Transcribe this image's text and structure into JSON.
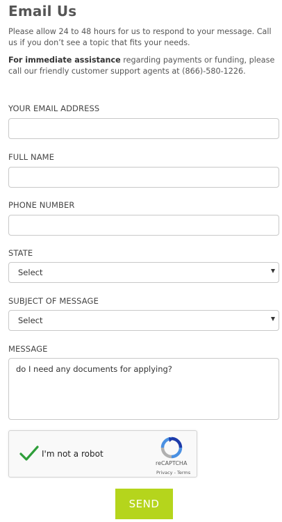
{
  "page": {
    "title": "Email Us",
    "intro": "Please allow 24 to 48 hours for us to respond to your message. Call us if you don’t see a topic that fits your needs.",
    "assist_strong": "For immediate assistance",
    "assist_rest": " regarding payments or funding, please call our friendly customer support agents at (866)-580-1226."
  },
  "form": {
    "email_label": "YOUR EMAIL ADDRESS",
    "email_value": "",
    "name_label": "FULL NAME",
    "name_value": "",
    "phone_label": "PHONE NUMBER",
    "phone_value": "",
    "state_label": "STATE",
    "state_value": "Select",
    "subject_label": "SUBJECT OF MESSAGE",
    "subject_value": "Select",
    "message_label": "MESSAGE",
    "message_value": "do I need any documents for applying?",
    "send_label": "SEND"
  },
  "captcha": {
    "text": "I'm not a robot",
    "brand": "reCAPTCHA",
    "terms": "Privacy - Terms",
    "checked": true
  },
  "colors": {
    "send_button": "#b5d51c",
    "check": "#2e9e3a",
    "title": "#555555"
  },
  "icons": {
    "check": "checkmark-icon",
    "recaptcha": "recaptcha-logo-icon",
    "dropdown": "chevron-down-icon"
  }
}
